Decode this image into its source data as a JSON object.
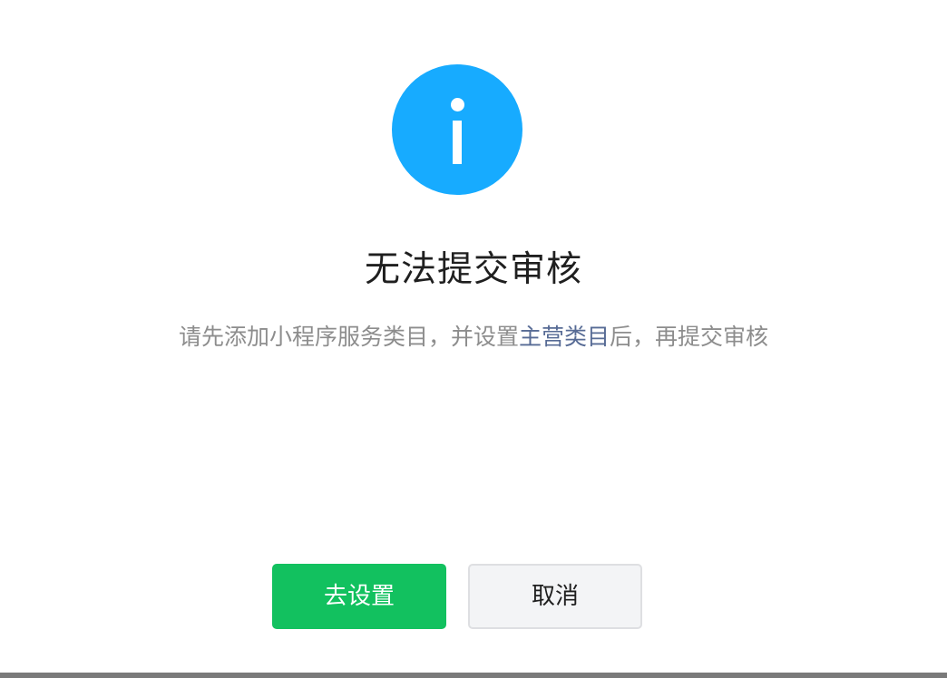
{
  "dialog": {
    "icon": "info-icon",
    "title": "无法提交审核",
    "desc_before": "请先添加小程序服务类目，并设置",
    "desc_link": "主营类目",
    "desc_after": "后，再提交审核",
    "primary_button_label": "去设置",
    "cancel_button_label": "取消"
  },
  "colors": {
    "icon_bg": "#17abff",
    "primary": "#12c15f",
    "link": "#576b95",
    "secondary_text": "#8d8d8d"
  }
}
